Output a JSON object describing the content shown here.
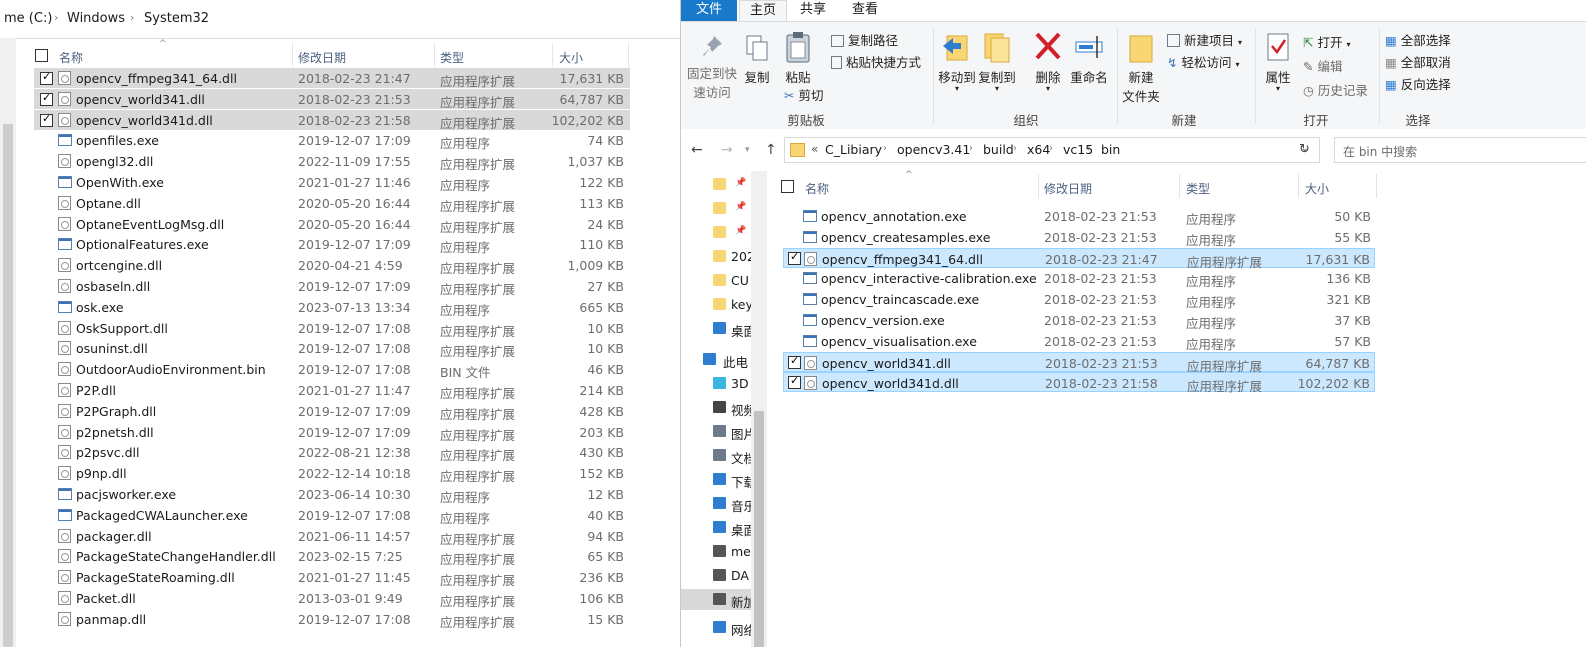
{
  "left": {
    "breadcrumb": [
      "me (C:)",
      "Windows",
      "System32"
    ],
    "columns": {
      "name": "名称",
      "date": "修改日期",
      "type": "类型",
      "size": "大小"
    },
    "files": [
      {
        "name": "opencv_ffmpeg341_64.dll",
        "date": "2018-02-23 21:47",
        "type": "应用程序扩展",
        "size": "17,631 KB",
        "selected": true,
        "icon": "dll"
      },
      {
        "name": "opencv_world341.dll",
        "date": "2018-02-23 21:53",
        "type": "应用程序扩展",
        "size": "64,787 KB",
        "selected": true,
        "icon": "dll"
      },
      {
        "name": "opencv_world341d.dll",
        "date": "2018-02-23 21:58",
        "type": "应用程序扩展",
        "size": "102,202 KB",
        "selected": true,
        "icon": "dll"
      },
      {
        "name": "openfiles.exe",
        "date": "2019-12-07 17:09",
        "type": "应用程序",
        "size": "74 KB",
        "selected": false,
        "icon": "exe"
      },
      {
        "name": "opengl32.dll",
        "date": "2022-11-09 17:55",
        "type": "应用程序扩展",
        "size": "1,037 KB",
        "selected": false,
        "icon": "dll"
      },
      {
        "name": "OpenWith.exe",
        "date": "2021-01-27 11:46",
        "type": "应用程序",
        "size": "122 KB",
        "selected": false,
        "icon": "exe"
      },
      {
        "name": "Optane.dll",
        "date": "2020-05-20 16:44",
        "type": "应用程序扩展",
        "size": "113 KB",
        "selected": false,
        "icon": "dll"
      },
      {
        "name": "OptaneEventLogMsg.dll",
        "date": "2020-05-20 16:44",
        "type": "应用程序扩展",
        "size": "24 KB",
        "selected": false,
        "icon": "dll"
      },
      {
        "name": "OptionalFeatures.exe",
        "date": "2019-12-07 17:09",
        "type": "应用程序",
        "size": "110 KB",
        "selected": false,
        "icon": "exe"
      },
      {
        "name": "ortcengine.dll",
        "date": "2020-04-21 4:59",
        "type": "应用程序扩展",
        "size": "1,009 KB",
        "selected": false,
        "icon": "dll"
      },
      {
        "name": "osbaseln.dll",
        "date": "2019-12-07 17:09",
        "type": "应用程序扩展",
        "size": "27 KB",
        "selected": false,
        "icon": "dll"
      },
      {
        "name": "osk.exe",
        "date": "2023-07-13 13:34",
        "type": "应用程序",
        "size": "665 KB",
        "selected": false,
        "icon": "exe"
      },
      {
        "name": "OskSupport.dll",
        "date": "2019-12-07 17:08",
        "type": "应用程序扩展",
        "size": "10 KB",
        "selected": false,
        "icon": "dll"
      },
      {
        "name": "osuninst.dll",
        "date": "2019-12-07 17:08",
        "type": "应用程序扩展",
        "size": "10 KB",
        "selected": false,
        "icon": "dll"
      },
      {
        "name": "OutdoorAudioEnvironment.bin",
        "date": "2019-12-07 17:08",
        "type": "BIN 文件",
        "size": "46 KB",
        "selected": false,
        "icon": "file"
      },
      {
        "name": "P2P.dll",
        "date": "2021-01-27 11:47",
        "type": "应用程序扩展",
        "size": "214 KB",
        "selected": false,
        "icon": "dll"
      },
      {
        "name": "P2PGraph.dll",
        "date": "2019-12-07 17:09",
        "type": "应用程序扩展",
        "size": "428 KB",
        "selected": false,
        "icon": "dll"
      },
      {
        "name": "p2pnetsh.dll",
        "date": "2019-12-07 17:09",
        "type": "应用程序扩展",
        "size": "203 KB",
        "selected": false,
        "icon": "dll"
      },
      {
        "name": "p2psvc.dll",
        "date": "2022-08-21 12:38",
        "type": "应用程序扩展",
        "size": "430 KB",
        "selected": false,
        "icon": "dll"
      },
      {
        "name": "p9np.dll",
        "date": "2022-12-14 10:18",
        "type": "应用程序扩展",
        "size": "152 KB",
        "selected": false,
        "icon": "dll"
      },
      {
        "name": "pacjsworker.exe",
        "date": "2023-06-14 10:30",
        "type": "应用程序",
        "size": "12 KB",
        "selected": false,
        "icon": "exe"
      },
      {
        "name": "PackagedCWALauncher.exe",
        "date": "2019-12-07 17:08",
        "type": "应用程序",
        "size": "40 KB",
        "selected": false,
        "icon": "exe"
      },
      {
        "name": "packager.dll",
        "date": "2021-06-11 14:57",
        "type": "应用程序扩展",
        "size": "94 KB",
        "selected": false,
        "icon": "dll"
      },
      {
        "name": "PackageStateChangeHandler.dll",
        "date": "2023-02-15 7:25",
        "type": "应用程序扩展",
        "size": "65 KB",
        "selected": false,
        "icon": "dll"
      },
      {
        "name": "PackageStateRoaming.dll",
        "date": "2021-01-27 11:45",
        "type": "应用程序扩展",
        "size": "236 KB",
        "selected": false,
        "icon": "dll"
      },
      {
        "name": "Packet.dll",
        "date": "2013-03-01 9:49",
        "type": "应用程序扩展",
        "size": "106 KB",
        "selected": false,
        "icon": "dll"
      },
      {
        "name": "panmap.dll",
        "date": "2019-12-07 17:08",
        "type": "应用程序扩展",
        "size": "15 KB",
        "selected": false,
        "icon": "dll"
      }
    ]
  },
  "right": {
    "tabs": [
      "文件",
      "主页",
      "共享",
      "查看"
    ],
    "ribbon": {
      "pin_quick_access": [
        "固定到快",
        "速访问"
      ],
      "copy": "复制",
      "paste": "粘贴",
      "copy_path": "复制路径",
      "paste_shortcut": "粘贴快捷方式",
      "cut": "剪切",
      "move_to": "移动到",
      "copy_to": "复制到",
      "delete": "删除",
      "rename": "重命名",
      "new_folder": [
        "新建",
        "文件夹"
      ],
      "new_item": "新建项目",
      "easy_access": "轻松访问",
      "properties": "属性",
      "open": "打开",
      "edit": "编辑",
      "history": "历史记录",
      "select_all": "全部选择",
      "select_none": "全部取消",
      "invert_selection": "反向选择",
      "groups": {
        "clipboard": "剪贴板",
        "organize": "组织",
        "new": "新建",
        "open": "打开",
        "select": "选择"
      }
    },
    "breadcrumb_prefix": "«",
    "breadcrumb": [
      "C_Libiary",
      "opencv3.41",
      "build",
      "x64",
      "vc15",
      "bin"
    ],
    "search_placeholder": "在 bin 中搜索",
    "nav_items": [
      {
        "label": "",
        "icon": "folder-pinned"
      },
      {
        "label": "",
        "icon": "folder-pinned"
      },
      {
        "label": "",
        "icon": "folder-pinned"
      },
      {
        "label": "202",
        "icon": "folder"
      },
      {
        "label": "CU",
        "icon": "folder"
      },
      {
        "label": "key",
        "icon": "folder"
      },
      {
        "label": "桌面",
        "icon": "desktop"
      },
      {
        "label": "此电",
        "icon": "computer"
      },
      {
        "label": "3D",
        "icon": "3d"
      },
      {
        "label": "视频",
        "icon": "video"
      },
      {
        "label": "图片",
        "icon": "picture"
      },
      {
        "label": "文档",
        "icon": "document"
      },
      {
        "label": "下载",
        "icon": "download"
      },
      {
        "label": "音乐",
        "icon": "music"
      },
      {
        "label": "桌面",
        "icon": "desktop"
      },
      {
        "label": "me",
        "icon": "drive"
      },
      {
        "label": "DA",
        "icon": "drive"
      },
      {
        "label": "新加",
        "icon": "drive"
      },
      {
        "label": "网络",
        "icon": "network"
      }
    ],
    "columns": {
      "name": "名称",
      "date": "修改日期",
      "type": "类型",
      "size": "大小"
    },
    "files": [
      {
        "name": "opencv_annotation.exe",
        "date": "2018-02-23 21:53",
        "type": "应用程序",
        "size": "50 KB",
        "selected": false,
        "icon": "exe"
      },
      {
        "name": "opencv_createsamples.exe",
        "date": "2018-02-23 21:53",
        "type": "应用程序",
        "size": "55 KB",
        "selected": false,
        "icon": "exe"
      },
      {
        "name": "opencv_ffmpeg341_64.dll",
        "date": "2018-02-23 21:47",
        "type": "应用程序扩展",
        "size": "17,631 KB",
        "selected": true,
        "icon": "dll"
      },
      {
        "name": "opencv_interactive-calibration.exe",
        "date": "2018-02-23 21:53",
        "type": "应用程序",
        "size": "136 KB",
        "selected": false,
        "icon": "exe"
      },
      {
        "name": "opencv_traincascade.exe",
        "date": "2018-02-23 21:53",
        "type": "应用程序",
        "size": "321 KB",
        "selected": false,
        "icon": "exe"
      },
      {
        "name": "opencv_version.exe",
        "date": "2018-02-23 21:53",
        "type": "应用程序",
        "size": "37 KB",
        "selected": false,
        "icon": "exe"
      },
      {
        "name": "opencv_visualisation.exe",
        "date": "2018-02-23 21:53",
        "type": "应用程序",
        "size": "57 KB",
        "selected": false,
        "icon": "exe"
      },
      {
        "name": "opencv_world341.dll",
        "date": "2018-02-23 21:53",
        "type": "应用程序扩展",
        "size": "64,787 KB",
        "selected": true,
        "icon": "dll"
      },
      {
        "name": "opencv_world341d.dll",
        "date": "2018-02-23 21:58",
        "type": "应用程序扩展",
        "size": "102,202 KB",
        "selected": true,
        "icon": "dll"
      }
    ]
  }
}
